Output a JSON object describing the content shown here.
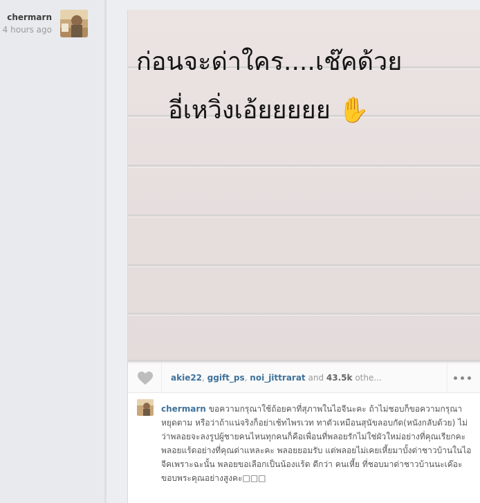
{
  "post_author": {
    "username": "chermarn",
    "timestamp": "4 hours ago"
  },
  "photo": {
    "line_1": "ก่อนจะด่าใคร....เช๊คด้วย",
    "line_2": "อี่เหวิ่งเอ้ยยยยย ✋"
  },
  "actions": {
    "like_icon": "heart-icon",
    "likers": [
      "akie22",
      "ggift_ps",
      "noi_jittrarat"
    ],
    "and_text": "and",
    "like_count": "43.5k",
    "others_text": "othe...",
    "more_icon": "more-options-icon"
  },
  "comment": {
    "username": "chermarn",
    "text": "ขอความกรุณาใช้ถ้อยคาที่สุภาพในไอจีนะคะ ถ้าไม่ชอบก็ขอความกรุณา หยุดตาม หรือว่าถ้าแน่จริงก็อย่าเช้ทไพรเวท ทาตัวเหมือนสุนัขลอบกัด(หนังกลับด้วย) ไม่ว่าพลอยจะลงรูปผู้ชายคนไหนทุกคนก็คือเพื่อนที่พลอยรักไม่ใช่ผัวใหม่อย่างที่คุณเรียกคะ พลอยแร้ดอย่างที่คุณด่าแหละคะ พลอยยอมรับ แต่พลอยไม่เคยเหี้ยมาบั้งด่าชาวบ้านในไอจีคเพราะฉะนั้น พลอยขอเลือกเป็นน้องแร้ด ดีกว่า คนเหี้ย ที่ชอบมาด่าชาวบ้านนะเค๊อะ ขอบพระคุณอย่างสูงคะ□□□"
  },
  "colors": {
    "username_link": "#3f729b",
    "background": "#eceef1",
    "card": "#ffffff"
  }
}
